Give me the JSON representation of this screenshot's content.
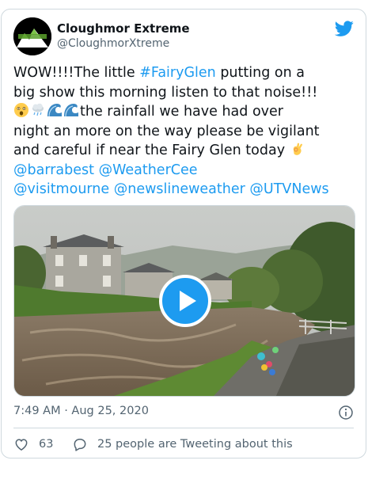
{
  "tweet": {
    "author_name": "Cloughmor Extreme",
    "author_handle": "@CloughmorXtreme",
    "avatar_text": "CLOUGHMOR EXTREME",
    "text_lines": [
      [
        {
          "t": "WOW!!!!The little "
        },
        {
          "t": "#FairyGlen",
          "link": true
        },
        {
          "t": " putting on a"
        }
      ],
      [
        {
          "t": "big show this morning listen to that noise!!!"
        }
      ],
      [
        {
          "emoji": "astonished-face-emoji"
        },
        {
          "emoji": "cloud-with-rain-emoji"
        },
        {
          "emoji": "water-wave-emoji"
        },
        {
          "emoji": "water-wave-emoji"
        },
        {
          "t": "the rainfall we have had over"
        }
      ],
      [
        {
          "t": "night an more on the way please be vigilant"
        }
      ],
      [
        {
          "t": "and careful if near the Fairy Glen today "
        },
        {
          "emoji": "ok-hand-emoji"
        }
      ],
      [
        {
          "t": "@barrabest",
          "link": true
        },
        {
          "t": " "
        },
        {
          "t": "@WeatherCee",
          "link": true
        }
      ],
      [
        {
          "t": "@visitmourne",
          "link": true
        },
        {
          "t": " "
        },
        {
          "t": "@newslineweather",
          "link": true
        },
        {
          "t": " "
        },
        {
          "t": "@UTVNews",
          "link": true
        }
      ]
    ],
    "timestamp": "7:49 AM · Aug 25, 2020",
    "likes": "63",
    "retweet_text": "25 people are Tweeting about this"
  },
  "icons": {
    "brand": "twitter-bird-icon",
    "info": "info-icon",
    "like": "heart-icon",
    "comment": "speech-bubble-icon",
    "play": "play-icon"
  },
  "colors": {
    "accent": "#1d9bf0",
    "text": "#0f1419",
    "secondary": "#536471",
    "border": "#cfd9de"
  }
}
